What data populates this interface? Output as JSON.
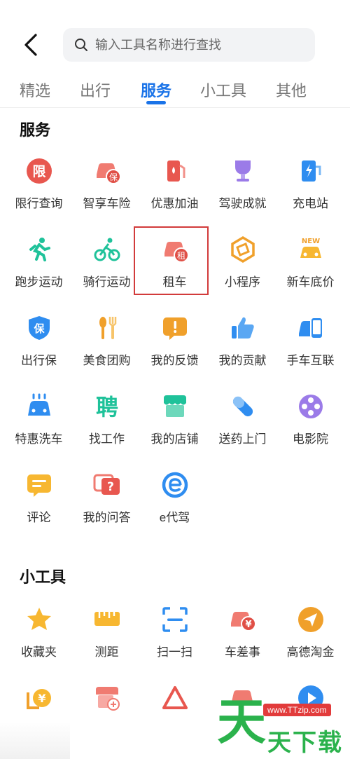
{
  "search": {
    "placeholder": "输入工具名称进行查找"
  },
  "tabs": [
    {
      "label": "精选"
    },
    {
      "label": "出行"
    },
    {
      "label": "服务"
    },
    {
      "label": "小工具"
    },
    {
      "label": "其他"
    }
  ],
  "active_tab": "服务",
  "services": {
    "title": "服务",
    "items": [
      {
        "label": "限行查询",
        "icon": "restriction-icon"
      },
      {
        "label": "智享车险",
        "icon": "car-insurance-icon"
      },
      {
        "label": "优惠加油",
        "icon": "fuel-icon"
      },
      {
        "label": "驾驶成就",
        "icon": "trophy-icon"
      },
      {
        "label": "充电站",
        "icon": "charging-icon"
      },
      {
        "label": "跑步运动",
        "icon": "running-icon"
      },
      {
        "label": "骑行运动",
        "icon": "cycling-icon"
      },
      {
        "label": "租车",
        "icon": "car-rental-icon"
      },
      {
        "label": "小程序",
        "icon": "mini-program-icon"
      },
      {
        "label": "新车底价",
        "icon": "new-car-icon"
      },
      {
        "label": "出行保",
        "icon": "travel-insurance-icon"
      },
      {
        "label": "美食团购",
        "icon": "food-icon"
      },
      {
        "label": "我的反馈",
        "icon": "feedback-icon"
      },
      {
        "label": "我的贡献",
        "icon": "thumbs-up-icon"
      },
      {
        "label": "手车互联",
        "icon": "phone-car-icon"
      },
      {
        "label": "特惠洗车",
        "icon": "car-wash-icon"
      },
      {
        "label": "找工作",
        "icon": "job-icon"
      },
      {
        "label": "我的店铺",
        "icon": "shop-icon"
      },
      {
        "label": "送药上门",
        "icon": "pill-icon"
      },
      {
        "label": "电影院",
        "icon": "film-icon"
      },
      {
        "label": "评论",
        "icon": "comment-icon"
      },
      {
        "label": "我的问答",
        "icon": "qa-icon"
      },
      {
        "label": "e代驾",
        "icon": "e-driver-icon"
      }
    ]
  },
  "tools": {
    "title": "小工具",
    "items": [
      {
        "label": "收藏夹",
        "icon": "star-icon"
      },
      {
        "label": "测距",
        "icon": "ruler-icon"
      },
      {
        "label": "扫一扫",
        "icon": "scan-icon"
      },
      {
        "label": "车差事",
        "icon": "car-errand-icon"
      },
      {
        "label": "高德淘金",
        "icon": "paper-plane-icon"
      },
      {
        "label": "",
        "icon": "yuan-car-icon"
      },
      {
        "label": "",
        "icon": "shop-add-icon"
      },
      {
        "label": "",
        "icon": "triangle-icon"
      },
      {
        "label": "",
        "icon": "car-partial-icon"
      },
      {
        "label": "",
        "icon": "play-icon"
      }
    ]
  },
  "watermark": {
    "url": "www.TTzip.com",
    "text": "天下载",
    "logo": "天"
  },
  "colors": {
    "accent": "#1a73e8",
    "highlight_border": "#d23b3b"
  }
}
